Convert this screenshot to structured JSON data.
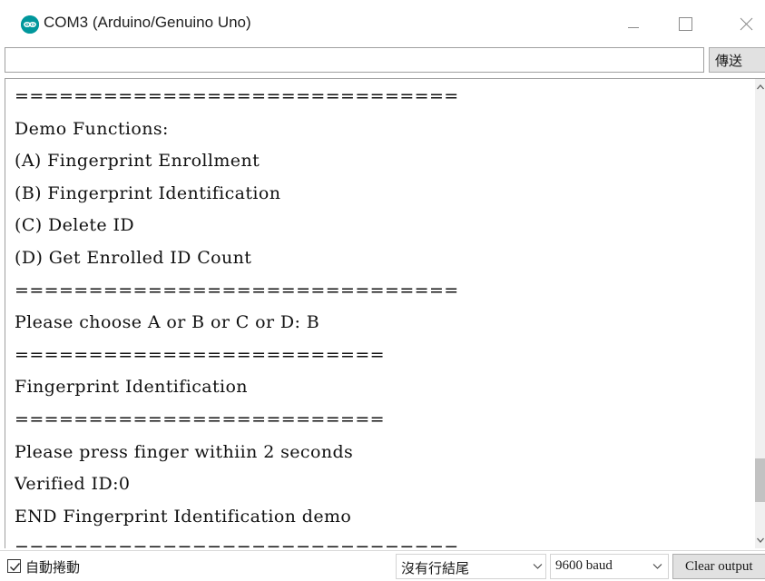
{
  "window": {
    "title": "COM3 (Arduino/Genuino Uno)",
    "icon": "arduino-logo-icon",
    "controls": [
      "minimize-icon",
      "maximize-icon",
      "close-icon"
    ]
  },
  "send": {
    "input_value": "",
    "button_label": "傳送"
  },
  "output": {
    "lines": [
      "==============================",
      "Demo Functions:",
      "(A) Fingerprint Enrollment",
      "(B) Fingerprint Identification",
      "(C) Delete ID",
      "(D) Get Enrolled ID Count",
      "==============================",
      "Please choose A or B or C or D: B",
      "=========================",
      "Fingerprint Identification",
      "=========================",
      "Please press finger withiin 2 seconds",
      "Verified ID:0",
      "END Fingerprint Identification demo",
      "=============================="
    ]
  },
  "footer": {
    "autoscroll_label": "自動捲動",
    "autoscroll_checked": true,
    "line_ending": "沒有行結尾",
    "baud": "9600 baud",
    "clear_label": "Clear output"
  },
  "colors": {
    "arduino_teal": "#00979c",
    "button_bg": "#e1e1e1",
    "scroll_thumb": "#c2c2c2"
  }
}
